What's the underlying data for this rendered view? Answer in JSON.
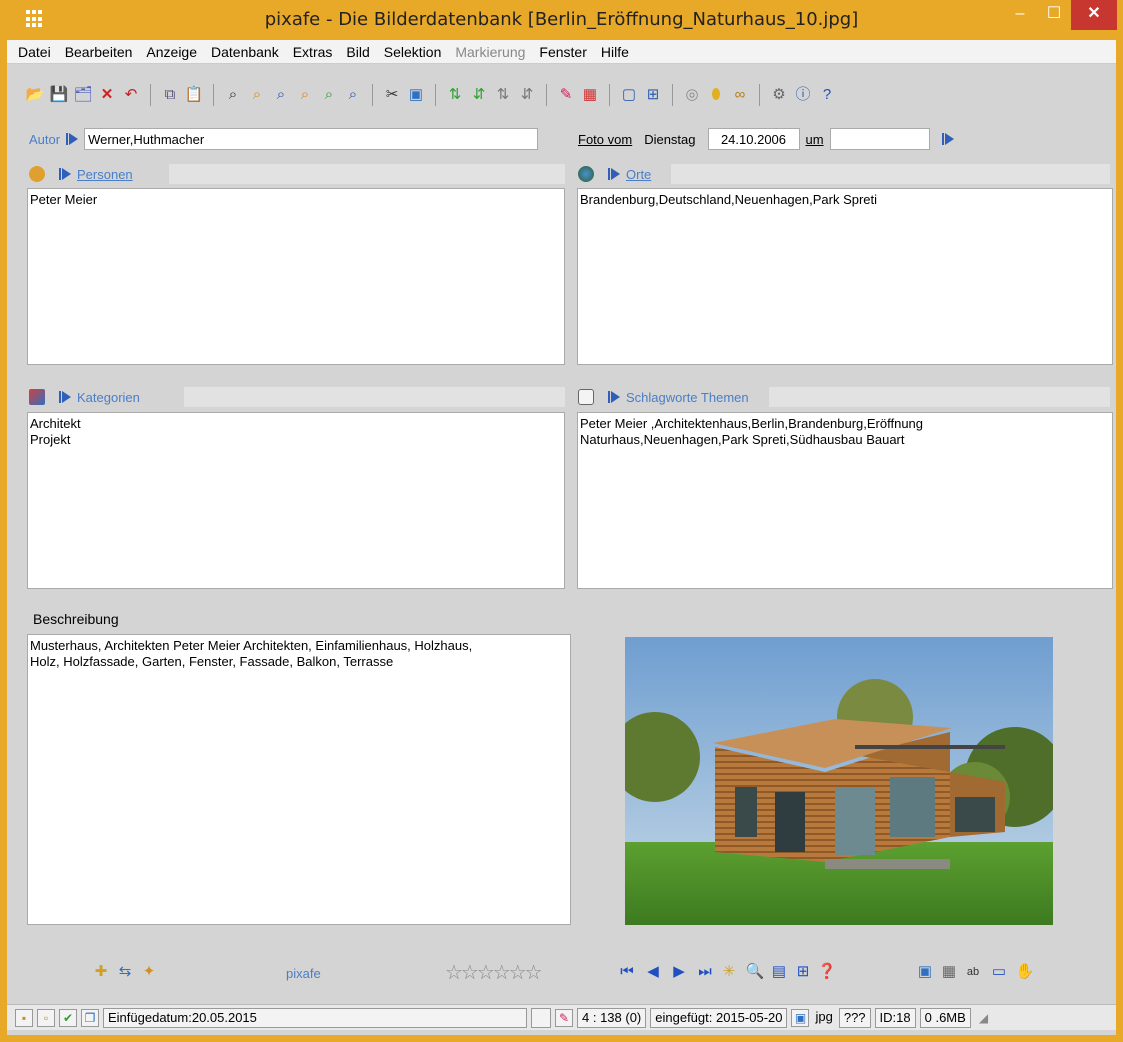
{
  "titlebar": {
    "title": "pixafe - Die Bilderdatenbank   [Berlin_Eröffnung_Naturhaus_10.jpg]",
    "min": "–",
    "max": "☐",
    "close": "✕"
  },
  "menu": [
    "Datei",
    "Bearbeiten",
    "Anzeige",
    "Datenbank",
    "Extras",
    "Bild",
    "Selektion",
    "Markierung",
    "Fenster",
    "Hilfe"
  ],
  "autor": {
    "label": "Autor",
    "value": "Werner,Huthmacher"
  },
  "foto": {
    "label": "Foto vom",
    "weekday": "Dienstag",
    "date": "24.10.2006",
    "um_label": "um",
    "time": ""
  },
  "personen": {
    "label": "Personen",
    "content": "Peter Meier"
  },
  "orte": {
    "label": "Orte",
    "content": "Brandenburg,Deutschland,Neuenhagen,Park Spreti"
  },
  "kategorien": {
    "label": "Kategorien",
    "content": "Architekt\nProjekt"
  },
  "schlagworte": {
    "label": "Schlagworte Themen",
    "content": "Peter Meier ,Architektenhaus,Berlin,Brandenburg,Eröffnung\nNaturhaus,Neuenhagen,Park Spreti,Südhausbau Bauart"
  },
  "beschreibung": {
    "label": "Beschreibung",
    "content": "Musterhaus, Architekten Peter Meier Architekten, Einfamilienhaus, Holzhaus,\nHolz, Holzfassade, Garten, Fenster, Fassade, Balkon, Terrasse"
  },
  "bottom": {
    "brand": "pixafe",
    "stars": "☆☆☆☆☆☆"
  },
  "status": {
    "einfuegedatum": "Einfügedatum:20.05.2015",
    "count": "4 : 138 (0)",
    "eingefuegt": "eingefügt: 2015-05-20",
    "format": "jpg",
    "unknown": "???",
    "id": "ID:18",
    "size": "0 .6MB"
  },
  "colors": {
    "accent": "#e8a828",
    "link": "#4a7ec8",
    "arrow": "#2f5fb8",
    "close": "#c7372f"
  }
}
